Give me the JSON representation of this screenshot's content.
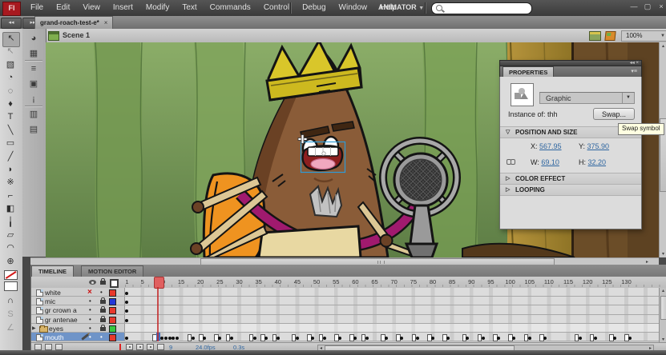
{
  "menu": {
    "logo": "Fl",
    "items": [
      "File",
      "Edit",
      "View",
      "Insert",
      "Modify",
      "Text",
      "Commands",
      "Control",
      "Debug",
      "Window",
      "Help"
    ],
    "workspace": "ANIMATOR",
    "workspace_arrow": "▼",
    "search_placeholder": ""
  },
  "window_controls": {
    "minimize": "—",
    "maximize": "▢",
    "close": "×"
  },
  "dock_buttons": {
    "left": "◂◂",
    "right": "▸▸"
  },
  "document": {
    "tab_title": "grand-roach-test-e*",
    "tab_close": "×"
  },
  "editbar": {
    "back_arrow": "◄",
    "scene_label": "Scene 1",
    "zoom_value": "100%",
    "zoom_arrow": "▼"
  },
  "toolbar": {
    "tools": [
      {
        "name": "selection-tool",
        "glyph": "↖",
        "selected": true
      },
      {
        "name": "subselection-tool",
        "glyph": "↖"
      },
      {
        "name": "free-transform-tool",
        "glyph": "▧"
      },
      {
        "name": "3d-rotation-tool",
        "glyph": "◔"
      },
      {
        "name": "lasso-tool",
        "glyph": "◌"
      },
      {
        "name": "pen-tool",
        "glyph": "♦"
      },
      {
        "name": "text-tool",
        "glyph": "T"
      },
      {
        "name": "line-tool",
        "glyph": "╲"
      },
      {
        "name": "rectangle-tool",
        "glyph": "▭"
      },
      {
        "name": "pencil-tool",
        "glyph": "╱"
      },
      {
        "name": "brush-tool",
        "glyph": "◗"
      },
      {
        "name": "deco-tool",
        "glyph": "※"
      },
      {
        "name": "bone-tool",
        "glyph": "⌐"
      },
      {
        "name": "paint-bucket-tool",
        "glyph": "◧"
      },
      {
        "name": "eyedropper-tool",
        "glyph": "╽"
      },
      {
        "name": "eraser-tool",
        "glyph": "▱"
      },
      {
        "name": "hand-tool",
        "glyph": "◠"
      },
      {
        "name": "zoom-tool",
        "glyph": "⊕"
      }
    ],
    "extras": [
      {
        "name": "snap-to-objects-toggle",
        "glyph": "∩"
      },
      {
        "name": "smooth-option",
        "glyph": "S"
      },
      {
        "name": "straighten-option",
        "glyph": "∠"
      }
    ]
  },
  "panel_dock": {
    "icons": [
      {
        "name": "color-panel-icon",
        "glyph": "◕"
      },
      {
        "name": "swatches-panel-icon",
        "glyph": "▦"
      },
      {
        "name": "align-panel-icon",
        "glyph": "≡"
      },
      {
        "name": "transform-panel-icon",
        "glyph": "▣"
      },
      {
        "name": "info-panel-icon",
        "glyph": "¡"
      },
      {
        "name": "library-panel-icon",
        "glyph": "▥"
      },
      {
        "name": "history-panel-icon",
        "glyph": "▤"
      }
    ]
  },
  "properties": {
    "collapse_icons": "◂◂ ×",
    "tab": "PROPERTIES",
    "panel_menu": "▾≡",
    "symbol_type": "Graphic",
    "dropdown_arrow": "▼",
    "instance_label": "Instance of:",
    "instance_name": "thh",
    "swap_button": "Swap...",
    "tooltip": "Swap symbol",
    "position_section": "POSITION AND SIZE",
    "color_section": "COLOR EFFECT",
    "looping_section": "LOOPING",
    "open_tri": "▽",
    "closed_tri": "▷",
    "x_label": "X:",
    "x_value": "567.95",
    "y_label": "Y:",
    "y_value": "375.90",
    "w_label": "W:",
    "w_value": "69.10",
    "h_label": "H:",
    "h_value": "32.20"
  },
  "timeline": {
    "tabs": [
      {
        "label": "TIMELINE",
        "active": true
      },
      {
        "label": "MOTION EDITOR",
        "active": false
      }
    ],
    "ruler_labels": [
      1,
      5,
      10,
      15,
      20,
      25,
      30,
      35,
      40,
      45,
      50,
      55,
      60,
      65,
      70,
      75,
      80,
      85,
      90,
      95,
      100,
      105,
      110,
      115,
      120,
      125,
      130
    ],
    "playhead_frame": 9,
    "layers": [
      {
        "name": "white",
        "icon": "layer",
        "eye": "hidden",
        "lock": "dot",
        "color": "#e8392c",
        "selected": false
      },
      {
        "name": "mic",
        "icon": "layer",
        "eye": "dot",
        "lock": "locked",
        "color": "#2438d8",
        "selected": false
      },
      {
        "name": "gr crown a",
        "icon": "layer",
        "eye": "dot",
        "lock": "locked",
        "color": "#e8392c",
        "selected": false
      },
      {
        "name": "gr antenae",
        "icon": "layer",
        "eye": "dot",
        "lock": "locked",
        "color": "#e8392c",
        "selected": false
      },
      {
        "name": "eyes",
        "icon": "folder",
        "eye": "dot",
        "lock": "locked",
        "color": "#35c840",
        "selected": false
      },
      {
        "name": "mouth",
        "icon": "layer",
        "editing": true,
        "eye": "dot",
        "lock": "dot",
        "color": "#e8392c",
        "selected": true
      }
    ],
    "mouth_keyframes": {
      "start_dot": 1,
      "hollow_before_selected": 8,
      "selected_frame": 9,
      "dots_after_selected": [
        10,
        11,
        12,
        13,
        14
      ],
      "pairs": [
        17,
        20,
        24,
        27,
        33,
        36,
        39,
        44,
        48,
        51,
        55,
        59,
        62,
        67,
        71,
        75,
        79,
        83,
        88,
        92,
        96,
        100,
        104,
        108,
        117,
        121,
        126,
        130
      ]
    },
    "controls": {
      "current_frame": "9",
      "frame_rate": "24.0fps",
      "elapsed_time": "0.3s"
    }
  }
}
